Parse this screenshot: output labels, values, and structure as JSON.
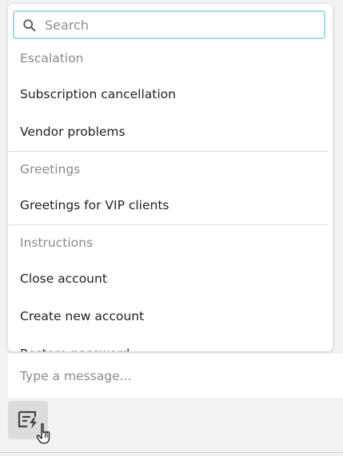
{
  "search": {
    "placeholder": "Search",
    "value": ""
  },
  "groups": [
    {
      "name": "Escalation",
      "items": [
        "Subscription cancellation",
        "Vendor problems"
      ]
    },
    {
      "name": "Greetings",
      "items": [
        "Greetings for VIP clients"
      ]
    },
    {
      "name": "Instructions",
      "items": [
        "Close account",
        "Create new account",
        "Restore password"
      ]
    }
  ],
  "composer": {
    "placeholder": "Type a message...",
    "value": ""
  },
  "icons": {
    "search": "search-icon",
    "canned_responses": "canned-responses-icon",
    "cursor": "hand-pointer-cursor"
  },
  "colors": {
    "search_border": "#a9d7ee",
    "muted_text": "#858a92",
    "primary_text": "#222222",
    "panel_bg": "#ffffff",
    "page_bg": "#f2f2f2",
    "button_bg": "#dcdcdc"
  }
}
